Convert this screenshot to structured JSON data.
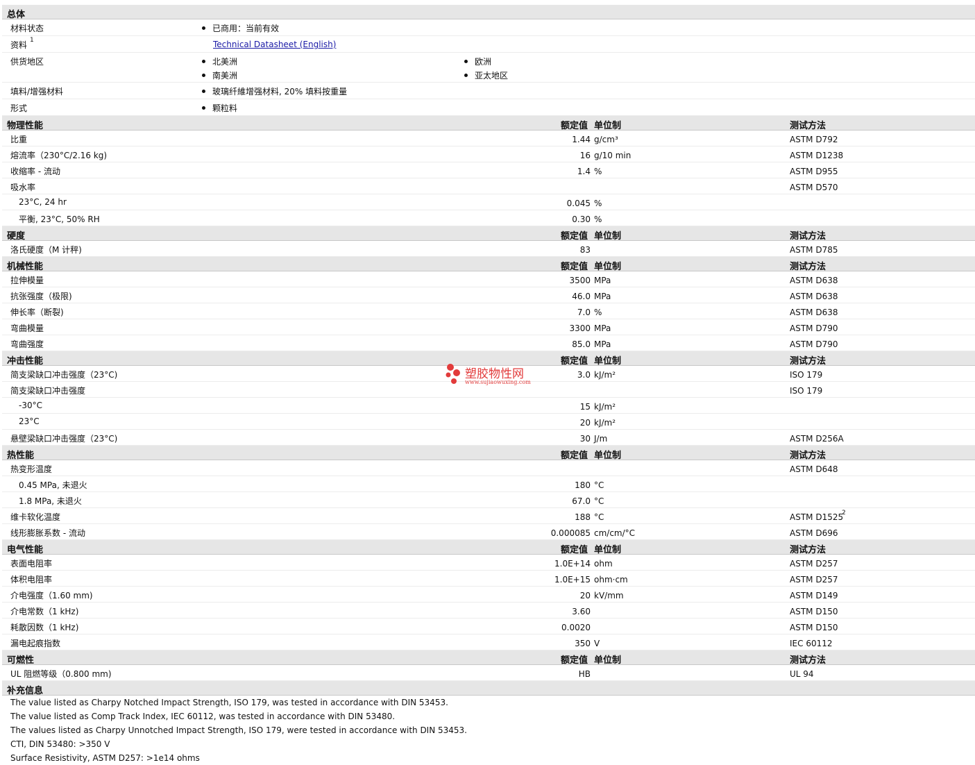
{
  "general": {
    "title": "总体",
    "rows": [
      {
        "label": "材料状态",
        "items": [
          "已商用：当前有效"
        ]
      },
      {
        "label": "资料",
        "sup": "1",
        "link": "Technical Datasheet (English)"
      },
      {
        "label": "供货地区",
        "items": [
          "北美洲",
          "南美洲"
        ],
        "items2": [
          "欧洲",
          "亚太地区"
        ]
      },
      {
        "label": "填料/增强材料",
        "items": [
          "玻璃纤維增强材料, 20% 填料按重量"
        ]
      },
      {
        "label": "形式",
        "items": [
          "颗粒料"
        ]
      }
    ]
  },
  "headers": {
    "value": "额定值",
    "unit": "单位制",
    "method": "测试方法"
  },
  "sections": [
    {
      "title": "物理性能",
      "rows": [
        {
          "label": "比重",
          "value": "1.44",
          "unit": "g/cm³",
          "method": "ASTM D792"
        },
        {
          "label": "熔流率（230°C/2.16 kg)",
          "value": "16",
          "unit": "g/10 min",
          "method": "ASTM D1238"
        },
        {
          "label": "收缩率 - 流动",
          "value": "1.4",
          "unit": "%",
          "method": "ASTM D955"
        },
        {
          "label": "吸水率",
          "value": "",
          "unit": "",
          "method": "ASTM D570"
        },
        {
          "label": "23°C, 24 hr",
          "sub": true,
          "value": "0.045",
          "unit": "%",
          "method": ""
        },
        {
          "label": "平衡, 23°C, 50% RH",
          "sub": true,
          "value": "0.30",
          "unit": "%",
          "method": ""
        }
      ]
    },
    {
      "title": "硬度",
      "rows": [
        {
          "label": "洛氏硬度（M 计秤)",
          "value": "83",
          "unit": "",
          "method": "ASTM D785"
        }
      ]
    },
    {
      "title": "机械性能",
      "rows": [
        {
          "label": "拉伸模量",
          "value": "3500",
          "unit": "MPa",
          "method": "ASTM D638"
        },
        {
          "label": "抗张强度（极限)",
          "value": "46.0",
          "unit": "MPa",
          "method": "ASTM D638"
        },
        {
          "label": "伸长率（断裂)",
          "value": "7.0",
          "unit": "%",
          "method": "ASTM D638"
        },
        {
          "label": "弯曲模量",
          "value": "3300",
          "unit": "MPa",
          "method": "ASTM D790"
        },
        {
          "label": "弯曲强度",
          "value": "85.0",
          "unit": "MPa",
          "method": "ASTM D790"
        }
      ]
    },
    {
      "title": "冲击性能",
      "rows": [
        {
          "label": "简支梁缺口冲击强度（23°C)",
          "value": "3.0",
          "unit": "kJ/m²",
          "method": "ISO 179"
        },
        {
          "label": "简支梁缺口冲击强度",
          "value": "",
          "unit": "",
          "method": "ISO 179"
        },
        {
          "label": "-30°C",
          "sub": true,
          "value": "15",
          "unit": "kJ/m²",
          "method": ""
        },
        {
          "label": "23°C",
          "sub": true,
          "value": "20",
          "unit": "kJ/m²",
          "method": ""
        },
        {
          "label": "悬壁梁缺口冲击强度（23°C)",
          "value": "30",
          "unit": "J/m",
          "method": "ASTM D256A"
        }
      ]
    },
    {
      "title": "热性能",
      "rows": [
        {
          "label": "热变形温度",
          "value": "",
          "unit": "",
          "method": "ASTM D648"
        },
        {
          "label": "0.45 MPa, 未退火",
          "sub": true,
          "value": "180",
          "unit": "°C",
          "method": ""
        },
        {
          "label": "1.8 MPa, 未退火",
          "sub": true,
          "value": "67.0",
          "unit": "°C",
          "method": ""
        },
        {
          "label": "维卡软化温度",
          "value": "188",
          "unit": "°C",
          "method": "ASTM D1525",
          "sup": "2"
        },
        {
          "label": "线形膨胀系数 - 流动",
          "value": "0.000085",
          "unit": "cm/cm/°C",
          "method": "ASTM D696"
        }
      ]
    },
    {
      "title": "电气性能",
      "rows": [
        {
          "label": "表面电阻率",
          "value": "1.0E+14",
          "unit": "ohm",
          "method": "ASTM D257"
        },
        {
          "label": "体积电阻率",
          "value": "1.0E+15",
          "unit": "ohm·cm",
          "method": "ASTM D257"
        },
        {
          "label": "介电强度（1.60 mm)",
          "value": "20",
          "unit": "kV/mm",
          "method": "ASTM D149"
        },
        {
          "label": "介电常数（1 kHz)",
          "value": "3.60",
          "unit": "",
          "method": "ASTM D150"
        },
        {
          "label": "耗散因数（1 kHz)",
          "value": "0.0020",
          "unit": "",
          "method": "ASTM D150"
        },
        {
          "label": "漏电起痕指数",
          "value": "350",
          "unit": "V",
          "method": "IEC 60112"
        }
      ]
    },
    {
      "title": "可燃性",
      "rows": [
        {
          "label": "UL 阻燃等级（0.800 mm)",
          "value": "HB",
          "unit": "",
          "method": "UL 94"
        }
      ]
    }
  ],
  "supplement": {
    "title": "补充信息",
    "notes": [
      "The value listed as Charpy Notched Impact Strength, ISO 179, was tested in accordance with DIN 53453.",
      "The value listed as Comp Track Index, IEC 60112, was tested in accordance with DIN 53480.",
      "The values listed as Charpy Unnotched Impact Strength, ISO 179, were tested in accordance with DIN 53453.",
      "CTI, DIN 53480: >350 V",
      "Surface Resistivity, ASTM D257: >1e14 ohms"
    ]
  },
  "watermark": {
    "text": "塑胶物性网",
    "url": "www.sujiaowuxing.com",
    "color": "#e23b3b"
  }
}
